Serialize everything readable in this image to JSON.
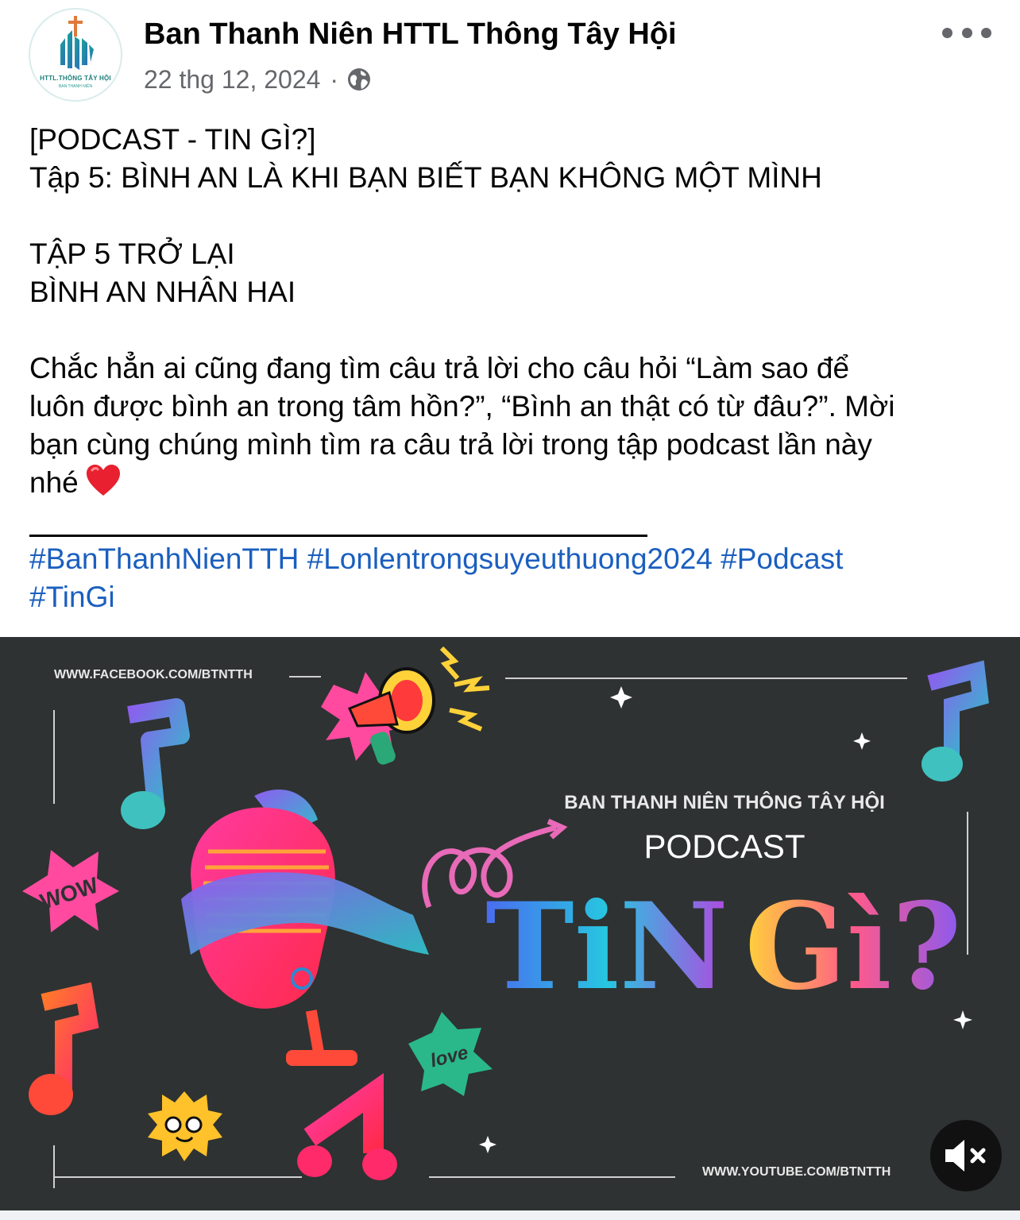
{
  "post": {
    "page_name": "Ban Thanh Niên HTTL Thông Tây Hội",
    "date": "22 thg 12, 2024",
    "separator": "·",
    "privacy_icon": "globe-icon",
    "more_icon": "more-horizontal-icon",
    "avatar": {
      "logo_text": "HTTL.THÔNG TÂY HỘI",
      "logo_subtext": "BAN THANH NIÊN"
    },
    "text_lines": [
      "[PODCAST - TIN GÌ?]",
      "Tập 5: BÌNH AN LÀ KHI BẠN BIẾT BẠN KHÔNG MỘT MÌNH",
      "",
      "TẬP 5 TRỞ LẠI",
      "BÌNH AN NHÂN HAI",
      "",
      "Chắc hẳn ai cũng đang tìm câu trả lời cho câu hỏi “Làm sao để",
      "luôn được bình an trong tâm hồn?”, “Bình an thật có từ đâu?”. Mời",
      "bạn cùng chúng mình tìm ra câu trả lời trong tập podcast lần này",
      "nhé"
    ],
    "hashtags": [
      "#BanThanhNienTTH",
      "#Lonlentrongsuyeuthuong2024",
      "#Podcast",
      "#TinGi"
    ]
  },
  "media": {
    "url_top": "WWW.FACEBOOK.COM/BTNTTH",
    "url_bottom": "WWW.YOUTUBE.COM/BTNTTH",
    "org_line": "BAN THANH NIÊN THÔNG TÂY HỘI",
    "podcast_label": "PODCAST",
    "title_word1": "TiN",
    "title_word2": "Gì?",
    "sticker_wow": "WOW",
    "sticker_love": "love",
    "mute_icon": "speaker-muted-icon",
    "background_color": "#2e3232"
  },
  "colors": {
    "text": "#050505",
    "secondary": "#65676b",
    "hashtag": "#1b5fbf",
    "brand_teal": "#1e7f7a"
  }
}
